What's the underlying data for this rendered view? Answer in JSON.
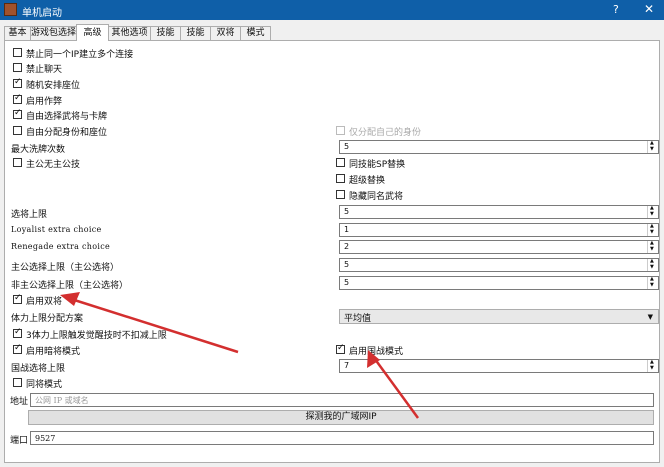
{
  "window": {
    "title": "单机启动",
    "help": "?",
    "close": "✕"
  },
  "tabs": [
    "基本",
    "游戏包选择",
    "高级",
    "其他选项",
    "技能",
    "技能",
    "双将",
    "模式"
  ],
  "active_tab": 2,
  "options": {
    "ban_same_ip": "禁止同一个IP建立多个连接",
    "ban_chat": "禁止聊天",
    "random_seat": "随机安排座位",
    "enable_cheat": "启用作弊",
    "free_choose": "自由选择武将与卡牌",
    "free_assign": "自由分配身份和座位",
    "only_self_role": "仅分配自己的身份",
    "max_shuffle_label": "最大洗牌次数",
    "max_shuffle_value": "5",
    "lord_no_skill": "主公无主公技",
    "same_skill_replace": "同技能SP替换",
    "super_replace": "超级替换",
    "hide_same_general": "隐藏同名武将",
    "choose_limit_label": "选将上限",
    "choose_limit_value": "5",
    "loyalist_label": "Loyalist extra choice",
    "loyalist_value": "1",
    "renegade_label": "Renegade extra choice",
    "renegade_value": "2",
    "lord_limit_label": "主公选择上限（主公选将）",
    "lord_limit_value": "5",
    "nonlord_limit_label": "非主公选择上限（主公选将）",
    "nonlord_limit_value": "5",
    "enable_double": "启用双将",
    "hp_plan_label": "体力上限分配方案",
    "hp_plan_value": "平均值",
    "hp_bonus": "3体力上限触发觉醒技时不扣减上限",
    "enable_hidden": "启用暗将模式",
    "enable_national_war": "启用国战模式",
    "national_limit_label": "国战选将上限",
    "national_limit_value": "7",
    "dual_mode": "同将模式"
  },
  "states": {
    "ban_same_ip": false,
    "ban_chat": false,
    "random_seat": true,
    "enable_cheat": true,
    "free_choose": true,
    "free_assign": false,
    "only_self_role": false,
    "lord_no_skill": false,
    "same_skill_replace": false,
    "super_replace": false,
    "hide_same_general": false,
    "enable_double": true,
    "hp_bonus": true,
    "enable_hidden": true,
    "enable_national_war": true,
    "dual_mode": false
  },
  "network": {
    "address_label": "地址",
    "address_placeholder": "公网 IP 或域名",
    "detect_button": "探测我的广域网IP",
    "port_label": "端口",
    "port_value": "9527"
  },
  "annotation_color": "#d32f2f"
}
